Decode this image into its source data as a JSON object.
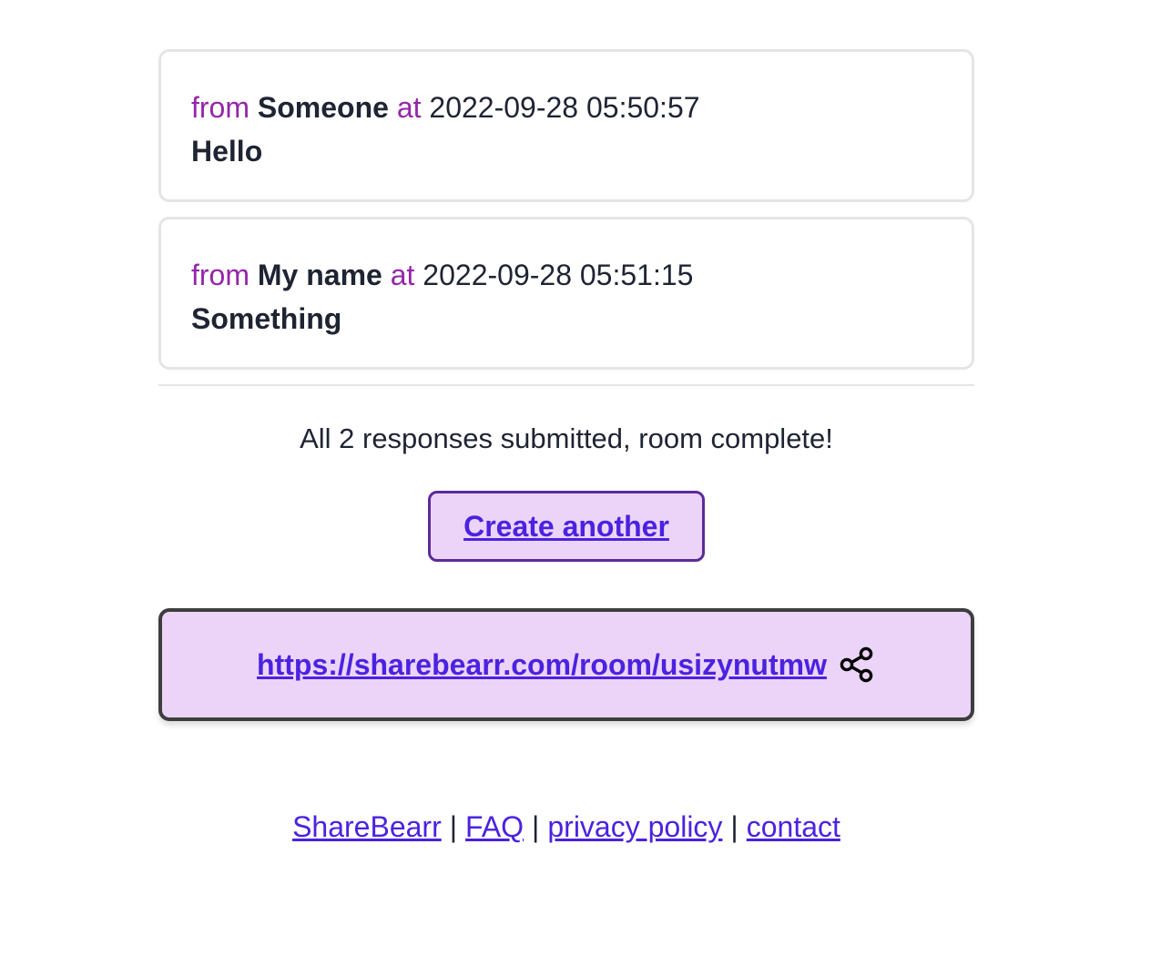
{
  "messages": [
    {
      "from_label": "from",
      "author": "Someone",
      "at_label": "at",
      "timestamp": "2022-09-28 05:50:57",
      "text": "Hello"
    },
    {
      "from_label": "from",
      "author": "My name",
      "at_label": "at",
      "timestamp": "2022-09-28 05:51:15",
      "text": "Something"
    }
  ],
  "status_text": "All 2 responses submitted, room complete!",
  "create_button_label": "Create another",
  "share": {
    "url": "https://sharebearr.com/room/usizynutmw",
    "icon": "share-icon"
  },
  "footer": {
    "links": [
      "ShareBearr",
      "FAQ",
      "privacy policy",
      "contact"
    ],
    "separator": "|"
  },
  "colors": {
    "accent_purple": "#9426a8",
    "link_blue": "#4b22e0",
    "button_bg": "#ecd4f8",
    "button_border": "#5b2b99"
  }
}
